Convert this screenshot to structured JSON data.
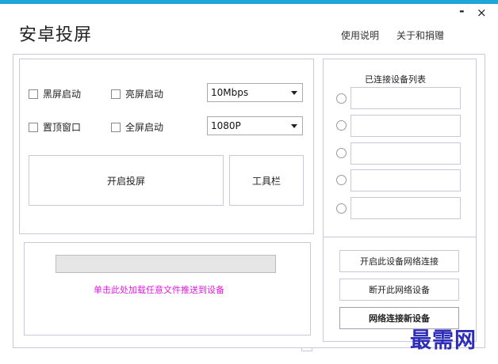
{
  "window": {
    "title": "安卓投屏",
    "minimize": "-",
    "close": "×"
  },
  "top_links": {
    "help": "使用说明",
    "about": "关于和捐赠"
  },
  "options": {
    "black_screen": "黑屏启动",
    "bright_screen": "亮屏启动",
    "always_on_top": "置顶窗口",
    "fullscreen": "全屏启动"
  },
  "bitrate_select": {
    "value": "10Mbps"
  },
  "resolution_select": {
    "value": "1080P"
  },
  "buttons": {
    "start_mirror": "开启投屏",
    "toolbar": "工具栏",
    "open_network": "开启此设备网络连接",
    "disconnect_network": "断开此网络设备",
    "connect_new": "网络连接新设备"
  },
  "file_push": {
    "progress": 0,
    "hint": "单击此处加载任意文件推送到设备"
  },
  "device_list": {
    "title": "已连接设备列表",
    "slots": [
      "",
      "",
      "",
      "",
      ""
    ]
  },
  "watermark": "最需网",
  "colors": {
    "accent": "#1fa6d8",
    "link_magenta": "#e01ae0",
    "watermark": "#2d2db8"
  }
}
